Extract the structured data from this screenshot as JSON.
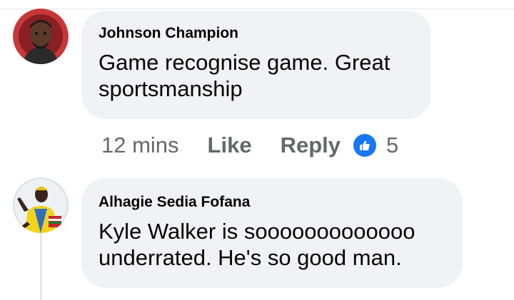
{
  "comments": [
    {
      "author": "Johnson Champion",
      "text": "Game recognise game. Great\nsportsmanship",
      "time": "12 mins",
      "like_label": "Like",
      "reply_label": "Reply",
      "reaction_icon": "thumbs-up-icon",
      "reaction_count": "5"
    },
    {
      "author": "Alhagie Sedia Fofana",
      "text": "Kyle Walker is sooooooooooooo\nunderrated. He's so good man."
    }
  ],
  "colors": {
    "bubble": "#f0f2f5",
    "meta_text": "#65676b",
    "like_blue": "#1877f2",
    "divider": "#e4e6eb"
  }
}
